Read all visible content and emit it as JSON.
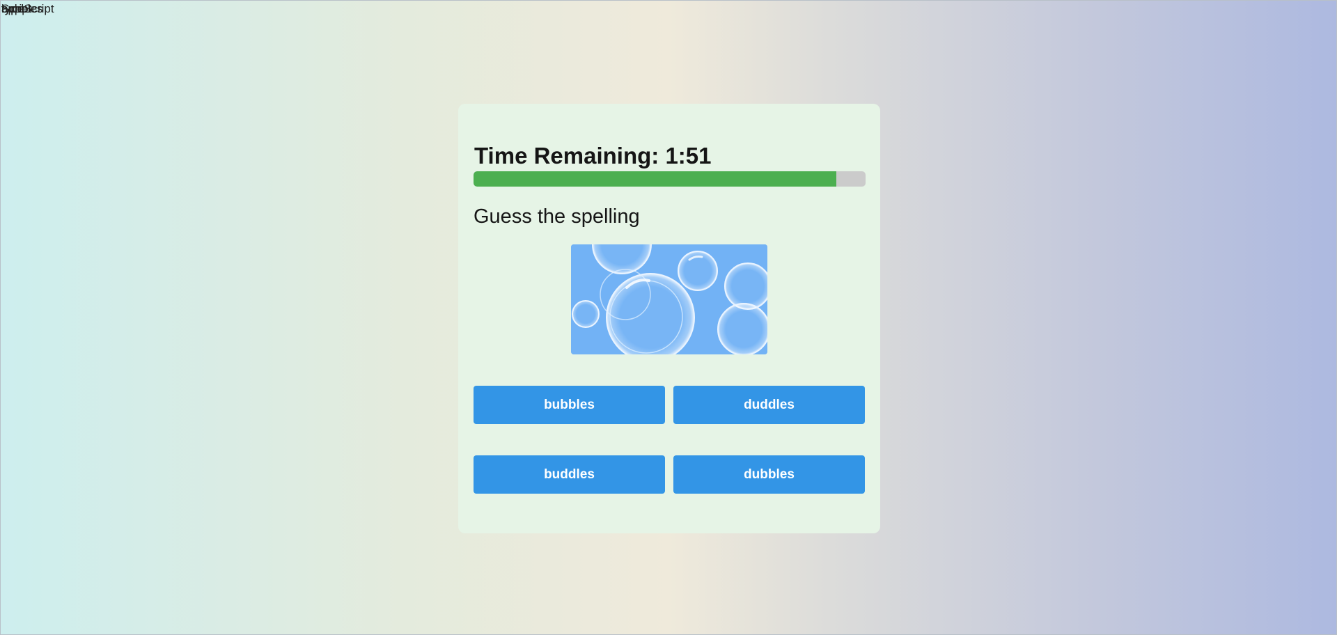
{
  "overlay": {
    "layers": [
      "typeScript",
      "bubbles",
      "Script",
      "type",
      "appe"
    ]
  },
  "game": {
    "timer_label": "Time Remaining: 1:51",
    "time_progress_fraction": 0.925,
    "prompt": "Guess the spelling",
    "picture_subject": "soap bubbles",
    "answers": [
      {
        "label": "bubbles"
      },
      {
        "label": "duddles"
      },
      {
        "label": "buddles"
      },
      {
        "label": "dubbles"
      }
    ]
  },
  "colors": {
    "progress_fill": "#4caf50",
    "progress_track": "#cbcbcb",
    "answer_button": "#3395e6",
    "card": "#e6f4e6",
    "picture_bg": "#72b2f5"
  }
}
